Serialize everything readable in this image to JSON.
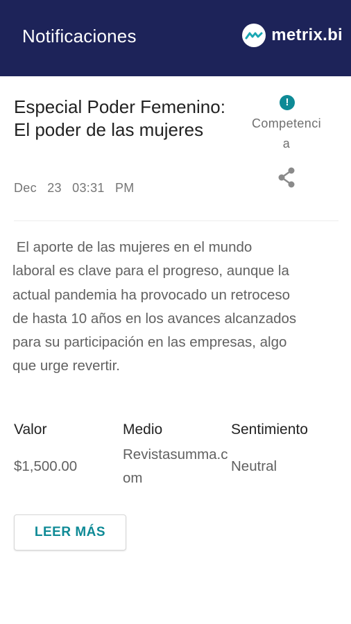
{
  "header": {
    "title": "Notificaciones",
    "brand_name": "metrix.bi",
    "brand_icon": "metrix-logo-icon",
    "background_color": "#1d2359"
  },
  "notification": {
    "headline": "Especial Poder Femenino: El poder de las mujeres",
    "date": "Dec 23",
    "time": "03:31 PM",
    "category_icon": "exclamation-icon",
    "category_icon_glyph": "!",
    "category_label": "Competencia",
    "share_icon": "share-icon",
    "summary": " El aporte de las mujeres en el mundo laboral es clave para el progreso, aunque la actual pandemia ha provocado un retroceso de hasta 10 años en los avances alcanzados para su participación en las empresas, algo que urge revertir.",
    "fields": {
      "valor_label": "Valor",
      "valor_value": "$1,500.00",
      "medio_label": "Medio",
      "medio_value": "Revistasumma.com",
      "sentimiento_label": "Sentimiento",
      "sentimiento_value": "Neutral"
    },
    "read_more_label": "LEER MÁS",
    "accent_color": "#0e8a96"
  }
}
